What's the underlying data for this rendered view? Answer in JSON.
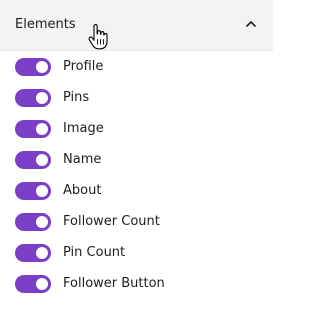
{
  "header": {
    "title": "Elements",
    "collapse_icon": "chevron-up-icon",
    "cursor_icon": "hand-pointer-icon"
  },
  "colors": {
    "toggle_on": "#7b3fc7",
    "header_bg": "#f3f3f3"
  },
  "elements": [
    {
      "label": "Profile",
      "enabled": true
    },
    {
      "label": "Pins",
      "enabled": true
    },
    {
      "label": "Image",
      "enabled": true
    },
    {
      "label": "Name",
      "enabled": true
    },
    {
      "label": "About",
      "enabled": true
    },
    {
      "label": "Follower Count",
      "enabled": true
    },
    {
      "label": "Pin Count",
      "enabled": true
    },
    {
      "label": "Follower Button",
      "enabled": true
    }
  ]
}
